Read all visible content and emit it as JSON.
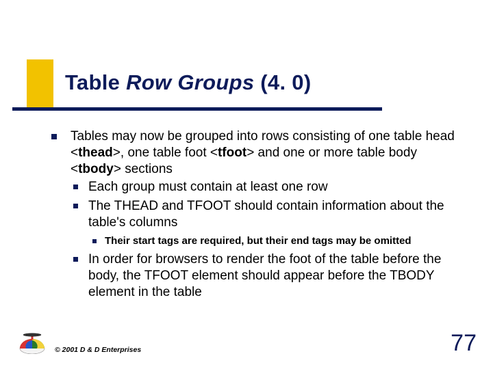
{
  "title": {
    "part1": "Table ",
    "italic": "Row Groups",
    "part2": " (4. 0)"
  },
  "bullets": {
    "l1_a_pre": "Tables may now be grouped into rows consisting of one table head <",
    "l1_a_kw1": "thead",
    "l1_a_mid1": ">, one table foot <",
    "l1_a_kw2": "tfoot",
    "l1_a_mid2": "> and one or more table body <",
    "l1_a_kw3": "tbody",
    "l1_a_post": "> sections",
    "l2_a": "Each group must contain at least one row",
    "l2_b": "The THEAD and TFOOT should contain information about the table's columns",
    "l3_a": "Their start tags are required, but their end tags may be omitted",
    "l2_c": "In order for browsers to render the foot of the table before the body, the TFOOT element should appear before the TBODY element in the table"
  },
  "footer": {
    "copyright": "© 2001 D & D Enterprises",
    "page": "77"
  }
}
